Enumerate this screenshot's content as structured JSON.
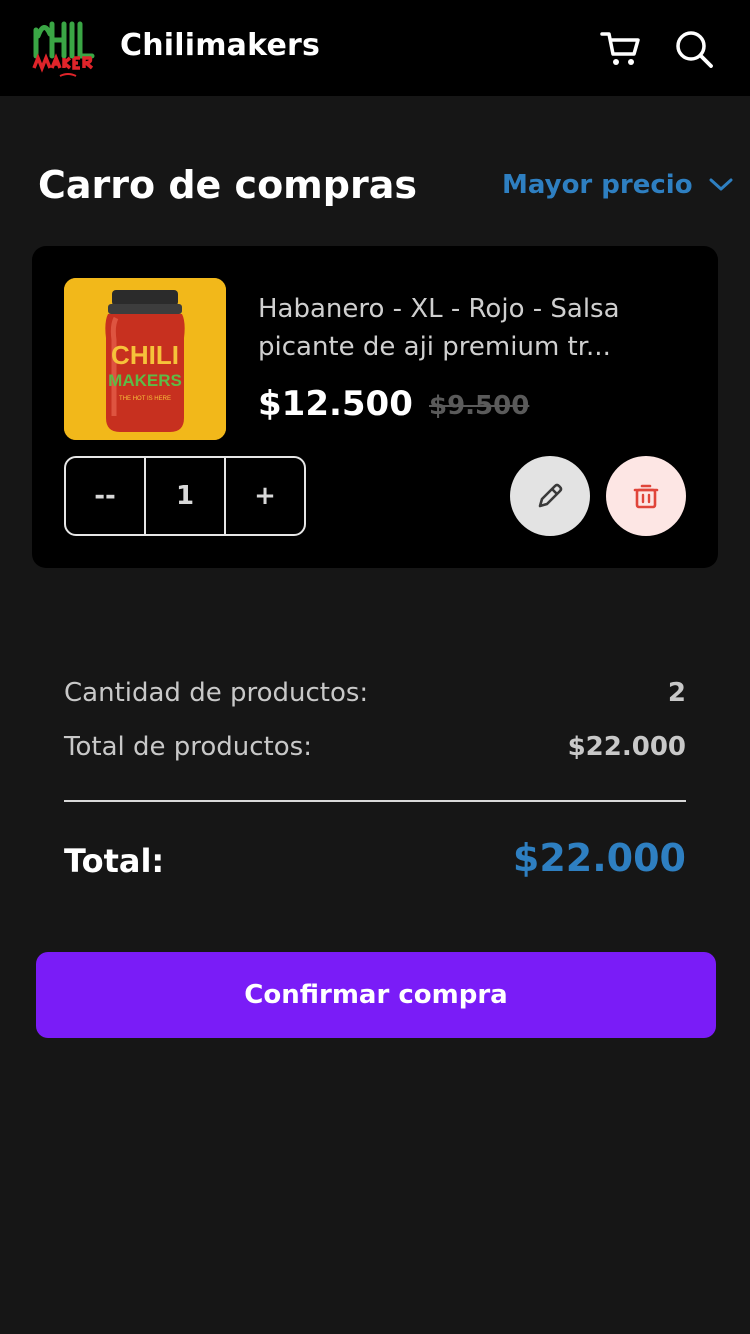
{
  "header": {
    "brand": "Chilimakers",
    "icons": [
      "logo",
      "cart-icon",
      "search-icon"
    ]
  },
  "page": {
    "title": "Carro de compras",
    "sort_label": "Mayor precio",
    "sort_icon": "chevron-down-icon"
  },
  "cart_item": {
    "name": "Habanero - XL - Rojo - Salsa picante de aji premium tr...",
    "price": "$12.500",
    "old_price": "$9.500",
    "decrement_label": "--",
    "quantity": "1",
    "increment_label": "+",
    "edit_icon": "pencil-icon",
    "delete_icon": "trash-icon"
  },
  "summary": {
    "quantity_label": "Cantidad de productos:",
    "quantity_value": "2",
    "subtotal_label": "Total de productos:",
    "subtotal_value": "$22.000",
    "total_label": "Total:",
    "total_value": "$22.000"
  },
  "actions": {
    "confirm_label": "Confirmar compra"
  },
  "colors": {
    "background": "#161616",
    "bar": "#000000",
    "accent_blue": "#2e7fc1",
    "confirm_purple": "#7a1cf7",
    "thumb_yellow": "#f2b81a",
    "delete_bg": "#fde6e4",
    "edit_bg": "#e3e3e3"
  }
}
